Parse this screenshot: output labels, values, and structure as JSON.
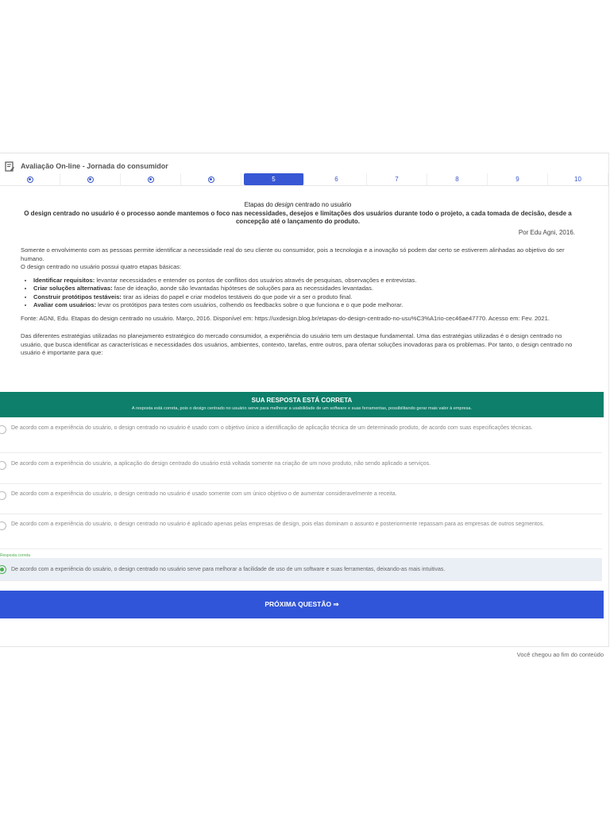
{
  "header": {
    "title": "Avaliação On-line - Jornada do consumidor",
    "icon": "document-edit-icon"
  },
  "steps": [
    {
      "label": "",
      "state": "done"
    },
    {
      "label": "",
      "state": "done"
    },
    {
      "label": "",
      "state": "done"
    },
    {
      "label": "",
      "state": "done"
    },
    {
      "label": "5",
      "state": "active"
    },
    {
      "label": "6",
      "state": "todo"
    },
    {
      "label": "7",
      "state": "todo"
    },
    {
      "label": "8",
      "state": "todo"
    },
    {
      "label": "9",
      "state": "todo"
    },
    {
      "label": "10",
      "state": "todo"
    }
  ],
  "content": {
    "title_pre": "Etapas do ",
    "title_em": "design",
    "title_post": " centrado no usuário",
    "intro": "O design centrado no usuário é o processo aonde mantemos o foco nas necessidades, desejos e limitações dos usuários durante todo o projeto, a cada tomada de decisão, desde a concepção até o lançamento do produto.",
    "attribution": "Por Edu Agni, 2016.",
    "p1": "Somente o envolvimento com as pessoas permite identificar a necessidade real do seu cliente ou consumidor, pois a tecnologia e a inovação só podem dar certo se estiverem alinhadas ao objetivo do ser humano.",
    "p2": "O design centrado no usuário possui quatro etapas básicas:",
    "bullets": [
      {
        "term": "Identificar requisitos:",
        "text": " levantar necessidades e entender os pontos de conflitos dos usuários através de pesquisas, observações e entrevistas."
      },
      {
        "term": "Criar soluções alternativas:",
        "text": " fase de ideação, aonde são levantadas hipóteses de soluções para as necessidades levantadas."
      },
      {
        "term": "Construir protótipos testáveis:",
        "text": " tirar as ideias do papel e criar modelos testáveis do que pode vir a ser o produto final."
      },
      {
        "term": "Avaliar com usuários:",
        "text": " levar os protótipos para testes com usuários, colhendo os feedbacks sobre o que funciona e o que pode melhorar."
      }
    ],
    "source": "Fonte: AGNI, Edu. Etapas do design centrado no usuário. Março, 2016. Disponível em: https://uxdesign.blog.br/etapas-do-design-centrado-no-usu%C3%A1rio-cec46ae47770. Acesso em: Fev. 2021.",
    "question": "Das diferentes estratégias utilizadas no planejamento estratégico do mercado consumidor, a experiência do usuário tem um destaque fundamental. Uma das estratégias utilizadas é o design centrado no usuário, que busca identificar as características e necessidades dos usuários, ambientes, contexto, tarefas, entre outros, para ofertar soluções inovadoras para os problemas. Por tanto, o design centrado no usuário é importante para que:"
  },
  "feedback": {
    "title": "SUA RESPOSTA ESTÁ CORRETA",
    "subtitle": "A resposta está correta, pois o design centrado no usuário serve para melhorar a usabilidade de um software e suas ferramentas, possibilitando gerar mais valor à empresa.",
    "color": "#0d7f6a"
  },
  "options": [
    {
      "text": "De acordo com a experiência do usuário, o design centrado no usuário é usado com o objetivo único a identificação de aplicação técnica de um determinado produto, de acordo com suas especificações técnicas."
    },
    {
      "text": "De acordo com a experiência do usuário, a aplicação do design centrado do usuário está voltada somente na criação de um novo produto, não sendo aplicado a serviços."
    },
    {
      "text": "De acordo com a experiência do usuário, o design centrado no usuário é usado somente com um único objetivo o de aumentar consideravelmente a receita."
    },
    {
      "text": "De acordo com a experiência do usuário, o design centrado no usuário é aplicado apenas pelas empresas de design, pois elas dominam o assunto e posteriormente repassam para as empresas de outros segmentos."
    },
    {
      "text": "De acordo com a experiência do usuário, o design centrado no usuário serve para melhorar a facilidade de uso de um software e suas ferramentas, deixando-as mais intuitivas."
    }
  ],
  "correct_label": "Resposta correta",
  "next_button": "PRÓXIMA QUESTÃO ⇒",
  "end_text": "Você chegou ao fim do conteúdo",
  "colors": {
    "primary": "#3155d8",
    "correct": "#4caf50"
  }
}
